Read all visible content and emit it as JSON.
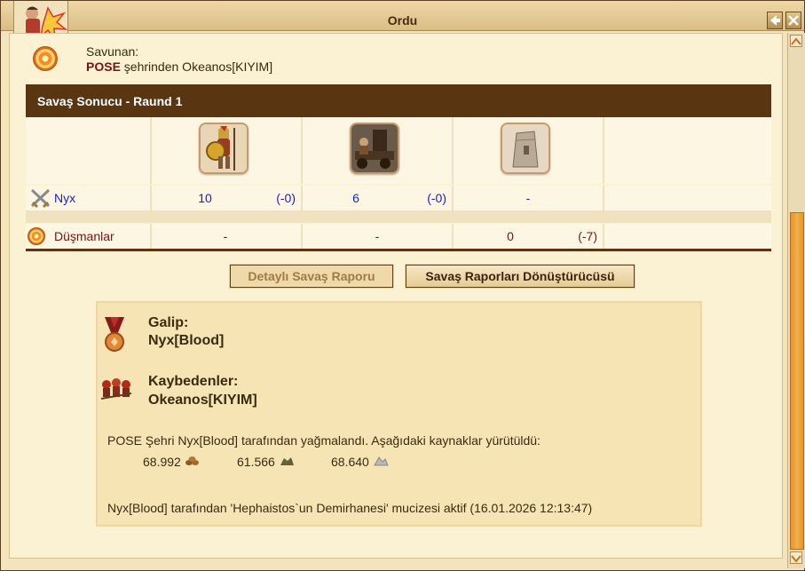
{
  "window": {
    "title": "Ordu"
  },
  "defender": {
    "label": "Savunan:",
    "city": "POSE",
    "text": "şehrinden Okeanos[KIYIM]"
  },
  "battle": {
    "banner": "Savaş Sonucu - Raund 1",
    "unit_icons": [
      "hoplite-icon",
      "catapult-icon",
      "tower-icon"
    ],
    "rows": [
      {
        "name": "Nyx",
        "cells": [
          {
            "count": "10",
            "loss": "(-0)"
          },
          {
            "count": "6",
            "loss": "(-0)"
          },
          {
            "count": "-",
            "loss": ""
          }
        ]
      },
      {
        "name": "Düşmanlar",
        "cells": [
          {
            "count": "-",
            "loss": ""
          },
          {
            "count": "-",
            "loss": ""
          },
          {
            "count": "0",
            "loss": "(-7)"
          }
        ]
      }
    ]
  },
  "buttons": {
    "detailed_report": "Detaylı Savaş Raporu",
    "report_converter": "Savaş Raporları Dönüştürücüsü"
  },
  "result": {
    "winner_label": "Galip:",
    "winner_name": "Nyx[Blood]",
    "losers_label": "Kaybedenler:",
    "losers_name": "Okeanos[KIYIM]",
    "plunder_text": "POSE Şehri Nyx[Blood] tarafından yağmalandı. Aşağıdaki kaynaklar yürütüldü:",
    "resources": [
      {
        "amount": "68.992",
        "icon": "wood-icon"
      },
      {
        "amount": "61.566",
        "icon": "stone-icon"
      },
      {
        "amount": "68.640",
        "icon": "silver-icon"
      }
    ],
    "wonder_text": "Nyx[Blood] tarafından 'Hephaistos`un Demirhanesi' mucizesi aktif (16.01.2026 12:13:47)"
  },
  "colors": {
    "banner": "#5a3512",
    "link_blue": "#1c1cd2",
    "enemy_red": "#7a1212",
    "scroll_thumb": "#f3b04a"
  }
}
